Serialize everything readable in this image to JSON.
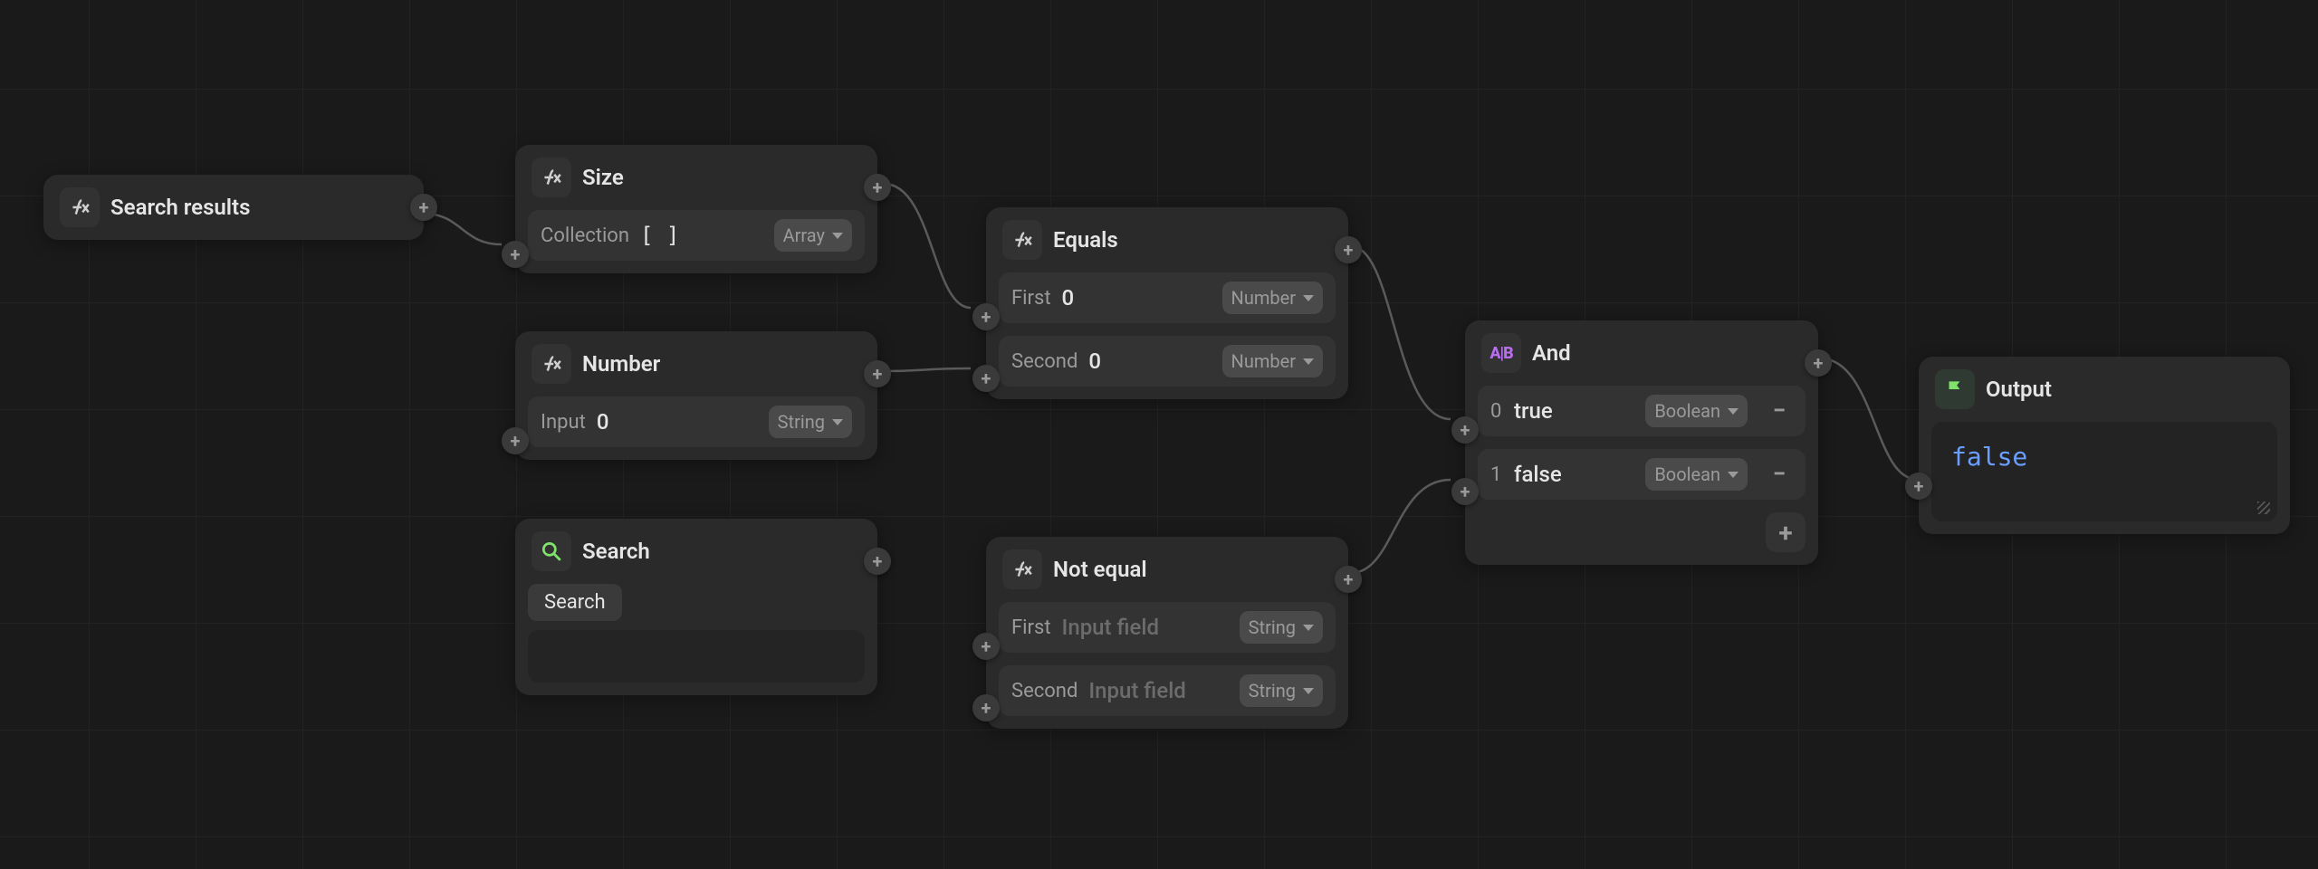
{
  "nodes": {
    "search_results": {
      "title": "Search results"
    },
    "size": {
      "title": "Size",
      "row": {
        "label": "Collection",
        "value": "[ ]",
        "type": "Array"
      }
    },
    "number": {
      "title": "Number",
      "row": {
        "label": "Input",
        "value": "0",
        "type": "String"
      }
    },
    "search": {
      "title": "Search",
      "tab": "Search"
    },
    "equals": {
      "title": "Equals",
      "rows": [
        {
          "label": "First",
          "value": "0",
          "type": "Number"
        },
        {
          "label": "Second",
          "value": "0",
          "type": "Number"
        }
      ]
    },
    "not_equal": {
      "title": "Not equal",
      "rows": [
        {
          "label": "First",
          "placeholder": "Input field",
          "type": "String"
        },
        {
          "label": "Second",
          "placeholder": "Input field",
          "type": "String"
        }
      ]
    },
    "and": {
      "title": "And",
      "rows": [
        {
          "index": "0",
          "value": "true",
          "type": "Boolean"
        },
        {
          "index": "1",
          "value": "false",
          "type": "Boolean"
        }
      ]
    },
    "output": {
      "title": "Output",
      "value": "false"
    }
  }
}
